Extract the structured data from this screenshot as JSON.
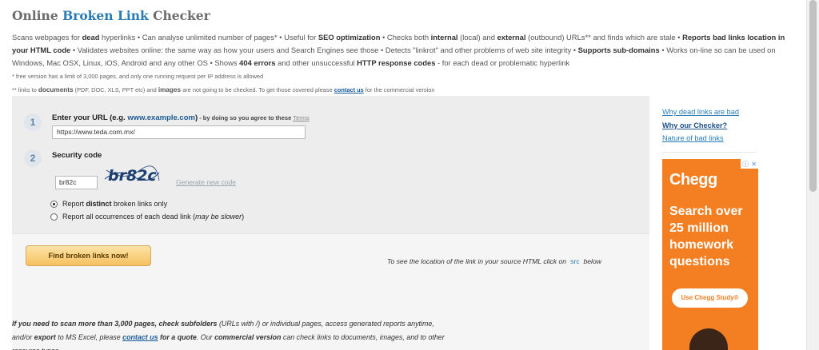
{
  "page": {
    "title_pre": "Online ",
    "title_blue": "Broken Link",
    "title_post": " Checker"
  },
  "intro": {
    "p1": "Scans webpages for ",
    "b1": "dead",
    "p2": " hyperlinks • Can analyse unlimited number of pages* • Useful for ",
    "b2": "SEO optimization",
    "p3": " • Checks both ",
    "b3": "internal",
    "p4": " (local) and ",
    "b4": "external",
    "p5": " (outbound) URLs** and finds which are stale • ",
    "b5": "Reports bad links location in your HTML code",
    "p6": " • Validates websites online: the same way as how your users and Search Engines see those • Detects \"linkrot\" and other problems of web site integrity • ",
    "b6": "Supports sub-domains",
    "p7": " • Works on-line so can be used on Windows, Mac OSX, Linux, iOS, Android and any other OS • Shows ",
    "b7": "404 errors",
    "p8": " and other unsuccessful ",
    "b8": "HTTP response codes",
    "p9": " - for each dead or problematic hyperlink"
  },
  "notes": {
    "note1": "* free version has a limit of 3,000 pages, and only one running request per IP address is allowed",
    "note2_pre": "** links to ",
    "note2_b1": "documents",
    "note2_mid1": " (PDF, DOC, XLS, PPT etc) and ",
    "note2_b2": "images",
    "note2_mid2": " are not going to be checked. To get those covered please ",
    "note2_link": "contact us",
    "note2_post": " for the commercial version"
  },
  "form": {
    "step1_number": "1",
    "step1_label_pre": "Enter your URL (e.g. ",
    "step1_label_example": "www.example.com",
    "step1_label_post": ")",
    "step1_small": " - by doing so you agree to these ",
    "step1_terms": "Terms",
    "url_value": "https://www.teda.com.mx/",
    "step2_number": "2",
    "step2_label": "Security code",
    "code_value": "br82c",
    "captcha_text": "br82c",
    "generate_new_code": "Generate new code",
    "radio1_pre": "Report ",
    "radio1_bold": "distinct",
    "radio1_post": " broken links only",
    "radio2_pre": "Report all occurrences of each dead link (",
    "radio2_italic": "may be slower",
    "radio2_post": ")",
    "find_button": "Find broken links now!",
    "src_hint_pre": "To see the location of the link in your source HTML click on",
    "src_hint_src": "src",
    "src_hint_post": "below"
  },
  "bottom": {
    "b1": "If you need to scan more than 3,000 pages, check subfolders",
    "t1": " (URLs with /) or individual pages, access generated reports anytime, and/or ",
    "b2": "export",
    "t2": " to MS Excel, please ",
    "link": "contact us",
    "b3": " for a quote",
    "t3": ". Our ",
    "b4": "commercial version",
    "t4": " can check links to documents, images, and to other resource types."
  },
  "sidebar": {
    "link1": "Why dead links are bad",
    "link2": "Why our Checker?",
    "link3": "Nature of bad links"
  },
  "ad": {
    "brand": "Chegg",
    "headline": "Search over 25 million homework questions",
    "cta": "Use Chegg Study®",
    "info_icon": "ⓘ",
    "close_icon": "✕",
    "accent": "#f47f22"
  }
}
